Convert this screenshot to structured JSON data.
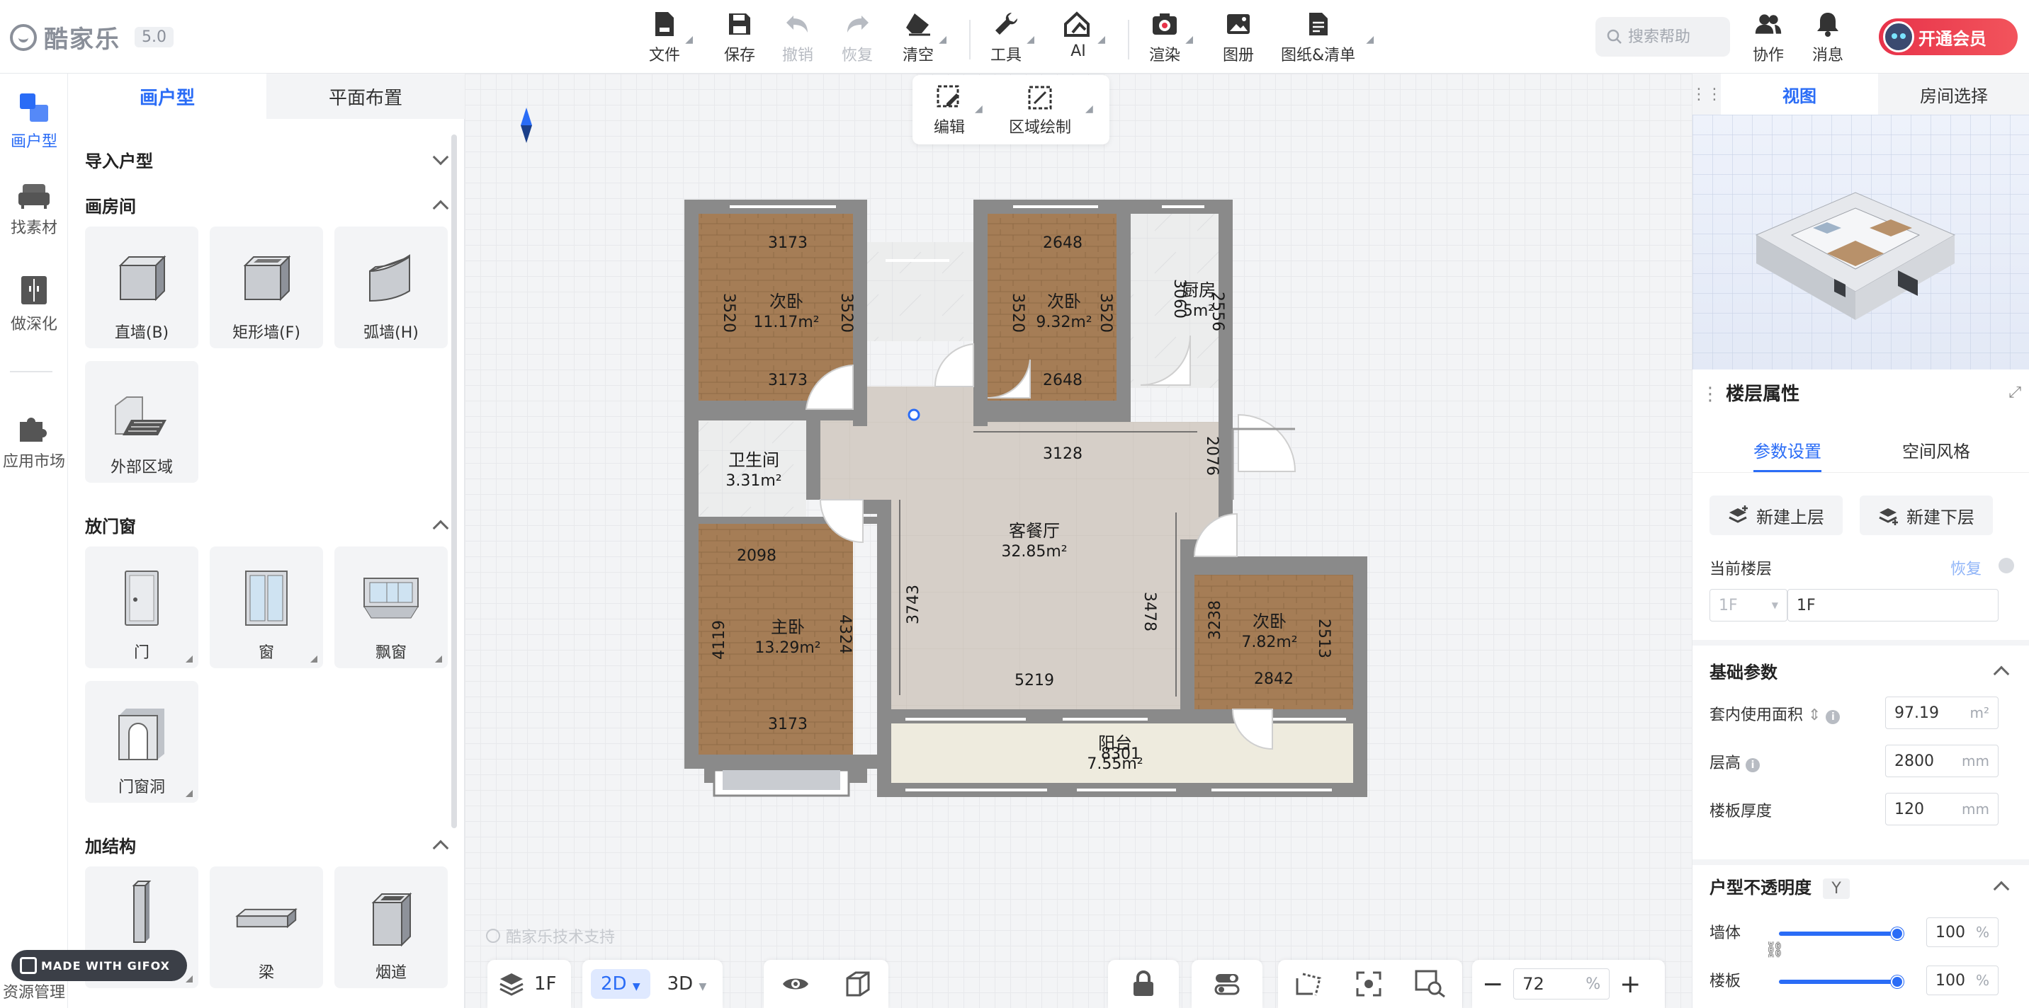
{
  "app": {
    "name": "酷家乐",
    "version": "5.0"
  },
  "toolbar": [
    {
      "key": "file",
      "label": "文件",
      "icon": "file-icon",
      "has_menu": true,
      "enabled": true
    },
    {
      "key": "save",
      "label": "保存",
      "icon": "save-icon",
      "has_menu": false,
      "enabled": true
    },
    {
      "key": "undo",
      "label": "撤销",
      "icon": "undo-icon",
      "has_menu": false,
      "enabled": false
    },
    {
      "key": "redo",
      "label": "恢复",
      "icon": "redo-icon",
      "has_menu": false,
      "enabled": false
    },
    {
      "key": "clear",
      "label": "清空",
      "icon": "eraser-icon",
      "has_menu": true,
      "enabled": true
    },
    {
      "key": "tools",
      "label": "工具",
      "icon": "wrench-icon",
      "has_menu": true,
      "enabled": true
    },
    {
      "key": "ai",
      "label": "AI",
      "icon": "ai-house-icon",
      "has_menu": true,
      "enabled": true
    },
    {
      "key": "render",
      "label": "渲染",
      "icon": "camera-icon",
      "has_menu": true,
      "enabled": true
    },
    {
      "key": "album",
      "label": "图册",
      "icon": "image-icon",
      "has_menu": false,
      "enabled": true
    },
    {
      "key": "drawings",
      "label": "图纸&清单",
      "icon": "document-icon",
      "has_menu": true,
      "enabled": true
    }
  ],
  "header_right": {
    "search_placeholder": "搜索帮助",
    "collab_label": "协作",
    "message_label": "消息",
    "vip_label": "开通会员",
    "vip_badge": "V"
  },
  "rail": [
    {
      "label": "画户型",
      "icon": "floorplan-icon",
      "active": true
    },
    {
      "label": "找素材",
      "icon": "sofa-icon",
      "active": false
    },
    {
      "label": "做深化",
      "icon": "cabinet-icon",
      "active": false
    },
    {
      "label": "应用市场",
      "icon": "puzzle-icon",
      "active": false
    },
    {
      "label": "资源管理",
      "icon": "folder-icon",
      "active": false
    }
  ],
  "left_panel": {
    "tabs": [
      {
        "label": "画户型",
        "active": true
      },
      {
        "label": "平面布置",
        "active": false
      }
    ],
    "sections": {
      "import": {
        "title": "导入户型",
        "expanded": false
      },
      "rooms": {
        "title": "画房间",
        "expanded": true,
        "items": [
          {
            "label": "直墙(B)"
          },
          {
            "label": "矩形墙(F)"
          },
          {
            "label": "弧墙(H)"
          },
          {
            "label": "外部区域"
          }
        ]
      },
      "doors": {
        "title": "放门窗",
        "expanded": true,
        "items": [
          {
            "label": "门"
          },
          {
            "label": "窗"
          },
          {
            "label": "飘窗"
          },
          {
            "label": "门窗洞"
          }
        ]
      },
      "structure": {
        "title": "加结构",
        "expanded": true,
        "items": [
          {
            "label": ""
          },
          {
            "label": "梁"
          },
          {
            "label": "烟道"
          }
        ]
      }
    }
  },
  "edit_toolbar": [
    {
      "label": "编辑",
      "icon": "edit-icon"
    },
    {
      "label": "区域绘制",
      "icon": "area-draw-icon"
    }
  ],
  "floorplan": {
    "rooms": [
      {
        "name": "次卧",
        "area": "11.17m²"
      },
      {
        "name": "次卧",
        "area": "9.32m²"
      },
      {
        "name": "厨房",
        "area": "5m²"
      },
      {
        "name": "卫生间",
        "area": "3.31m²"
      },
      {
        "name": "客餐厅",
        "area": "32.85m²"
      },
      {
        "name": "主卧",
        "area": "13.29m²"
      },
      {
        "name": "次卧",
        "area": "7.82m²"
      },
      {
        "name": "阳台",
        "area": "7.55m²"
      }
    ],
    "dims": {
      "b1_top": "3173",
      "b1_bottom": "3173",
      "b1_left": "3520",
      "b1_right": "3520",
      "b2_top": "2648",
      "b2_bottom": "2648",
      "b2_left": "3520",
      "b2_right": "3520",
      "k_left": "3060",
      "k_right": "2556",
      "living_top": "3128",
      "living_left": "3743",
      "living_right": "3478",
      "living_bottom": "5219",
      "living_door": "2076",
      "mb_top": "2098",
      "mb_bottom": "3173",
      "mb_left": "4119",
      "mb_right": "4324",
      "b3_left": "3238",
      "b3_right": "2513",
      "b3_bottom": "2842",
      "balcony": "8301"
    }
  },
  "watermark": "酷家乐技术支持",
  "gifox": "MADE WITH GIFOX",
  "bottom_bar": {
    "floor": "1F",
    "mode_2d": "2D",
    "mode_3d": "3D",
    "zoom_value": "72",
    "zoom_unit": "%"
  },
  "right_panel": {
    "view_tabs": [
      {
        "label": "视图",
        "active": true
      },
      {
        "label": "房间选择",
        "active": false
      }
    ],
    "floor_title": "楼层属性",
    "sub_tabs": [
      {
        "label": "参数设置",
        "active": true
      },
      {
        "label": "空间风格",
        "active": false
      }
    ],
    "add_upper": "新建上层",
    "add_lower": "新建下层",
    "current_floor_label": "当前楼层",
    "restore_label": "恢复",
    "floor_select": "1F",
    "floor_name": "1F",
    "basic_title": "基础参数",
    "params": [
      {
        "label": "套内使用面积",
        "value": "97.19",
        "unit": "m²"
      },
      {
        "label": "层高",
        "value": "2800",
        "unit": "mm"
      },
      {
        "label": "楼板厚度",
        "value": "120",
        "unit": "mm"
      }
    ],
    "opacity_title": "户型不透明度",
    "opacity_key": "Y",
    "opacity": [
      {
        "label": "墙体",
        "value": "100",
        "unit": "%",
        "level": 1.0
      },
      {
        "label": "楼板",
        "value": "100",
        "unit": "%",
        "level": 1.0
      }
    ]
  },
  "colors": {
    "accent": "#2a6cf6",
    "wall": "#8a8a8a",
    "wood": "#a8805a",
    "living": "#d9d3cc"
  }
}
